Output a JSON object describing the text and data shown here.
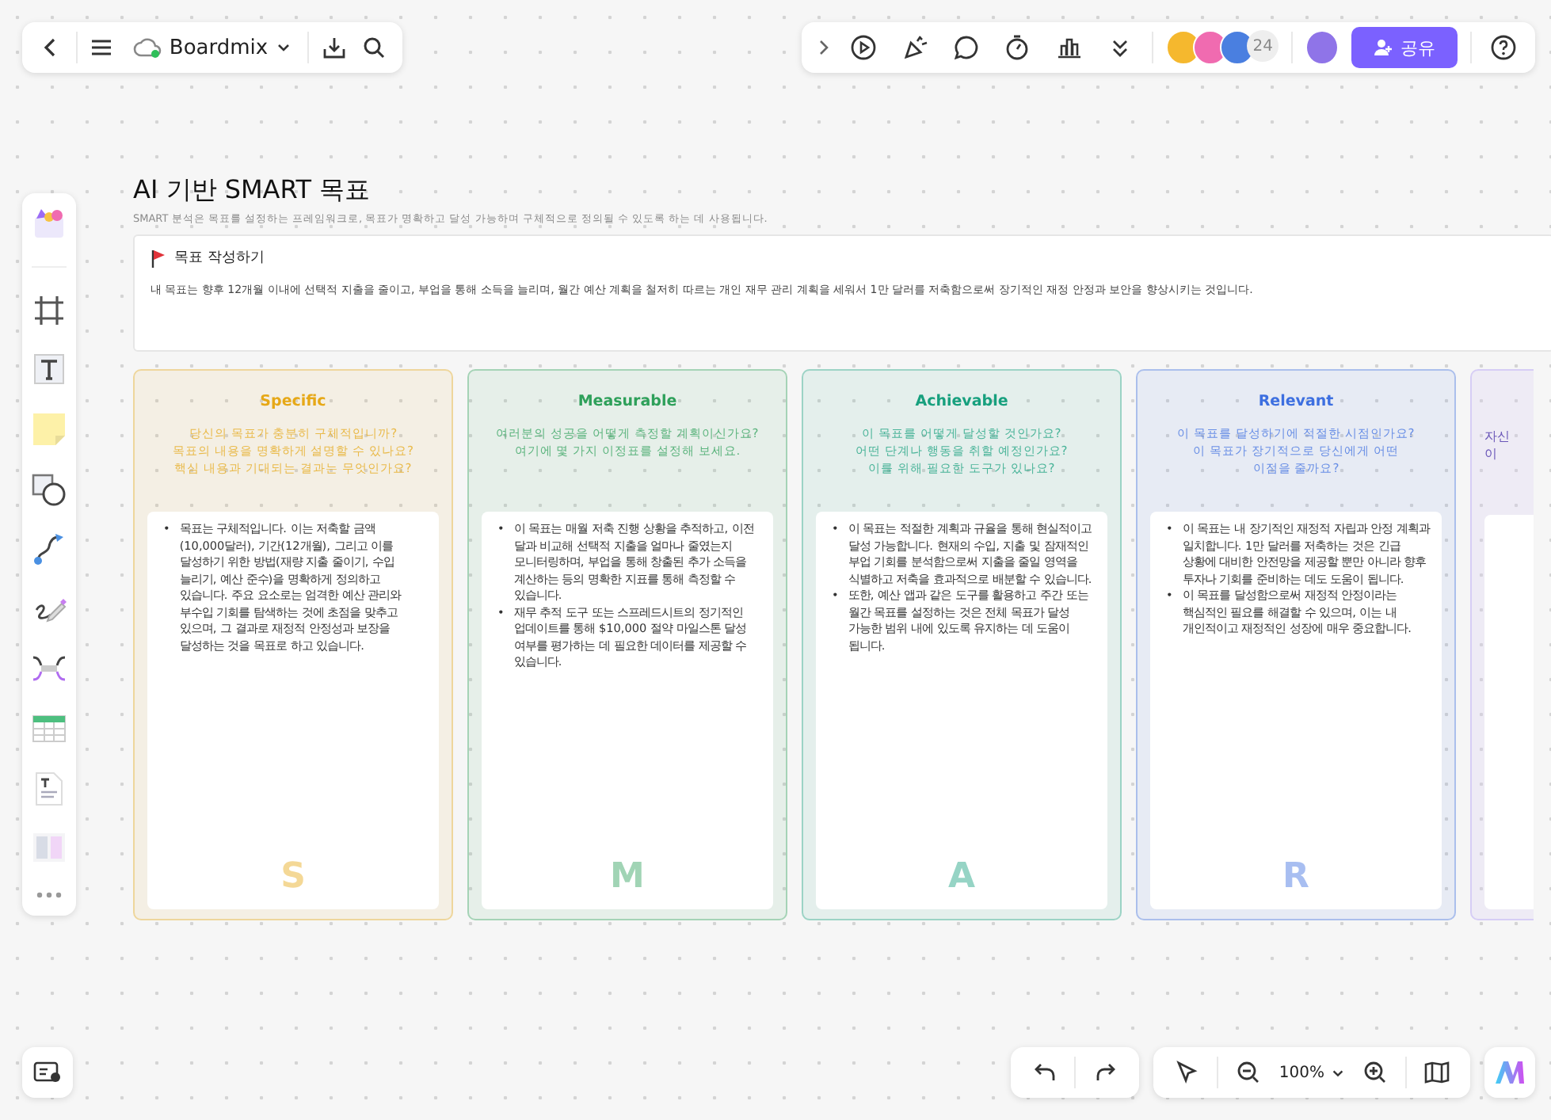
{
  "top_bar": {
    "app_name": "Boardmix"
  },
  "collab_bar": {
    "avatars": [
      {
        "color": "#f5b82e"
      },
      {
        "color": "#f06bb0"
      },
      {
        "color": "#4a7fe0"
      }
    ],
    "more_count": "24",
    "share_label": "공유"
  },
  "board": {
    "title": "AI 기반 SMART 목표",
    "subtitle": "SMART 분석은 목표를 설정하는 프레임워크로, 목표가 명확하고 달성 가능하며 구체적으로 정의될 수 있도록 하는 데 사용됩니다.",
    "goal": {
      "heading": "목표 작성하기",
      "text": "내 목표는 향후 12개월 이내에 선택적 지출을 줄이고, 부업을 통해 소득을 늘리며, 월간 예산 계획을 철저히 따르는 개인 재무 관리 계획을 세워서 1만 달러를 저축함으로써 장기적인 재정 안정과 보안을 향상시키는 것입니다."
    },
    "cards": [
      {
        "kind": "full",
        "color": "#e6a817",
        "title": "Specific",
        "questions": [
          "당신의 목표가 충분히 구체적입니까?",
          "목표의 내용을 명확하게 설명할 수 있나요?",
          "핵심 내용과 기대되는 결과는 무엇인가요?"
        ],
        "bullets": [
          "목표는 구체적입니다. 이는 저축할 금액(10,000달러), 기간(12개월), 그리고 이를 달성하기 위한 방법(재량 지출 줄이기, 수입 늘리기, 예산 준수)을 명확하게 정의하고 있습니다. 주요 요소로는 엄격한 예산 관리와 부수입 기회를 탐색하는 것에 초점을 맞추고 있으며, 그 결과로 재정적 안정성과 보장을 달성하는 것을 목표로 하고 있습니다."
        ],
        "letter": "S"
      },
      {
        "kind": "full",
        "color": "#2ea05a",
        "title": "Measurable",
        "questions": [
          "여러분의 성공을 어떻게 측정할 계획이신가요?",
          "여기에 몇 가지 이정표를 설정해 보세요."
        ],
        "bullets": [
          "이 목표는 매월 저축 진행 상황을 추적하고, 이전 달과 비교해 선택적 지출을 얼마나 줄였는지 모니터링하며, 부업을 통해 창출된 추가 소득을 계산하는 등의 명확한 지표를 통해 측정할 수 있습니다.",
          "재무 추적 도구 또는 스프레드시트의 정기적인 업데이트를 통해 $10,000 절약 마일스톤 달성 여부를 평가하는 데 필요한 데이터를 제공할 수 있습니다."
        ],
        "letter": "M"
      },
      {
        "kind": "full",
        "color": "#17a07e",
        "title": "Achievable",
        "questions": [
          "이 목표를 어떻게 달성할 것인가요?",
          "어떤 단계나 행동을 취할 예정인가요?",
          "이를 위해 필요한 도구가 있나요?"
        ],
        "bullets": [
          "이 목표는 적절한 계획과 규율을 통해 현실적이고 달성 가능합니다. 현재의 수입, 지출 및 잠재적인 부업 기회를 분석함으로써 지출을 줄일 영역을 식별하고 저축을 효과적으로 배분할 수 있습니다.",
          "또한, 예산 앱과 같은 도구를 활용하고 주간 또는 월간 목표를 설정하는 것은 전체 목표가 달성 가능한 범위 내에 있도록 유지하는 데 도움이 됩니다."
        ],
        "letter": "A"
      },
      {
        "kind": "full",
        "color": "#3d6fe0",
        "title": "Relevant",
        "questions": [
          "이 목표를 달성하기에 적절한 시점인가요?",
          "이 목표가 장기적으로 당신에게 어떤",
          "이점을 줄까요?"
        ],
        "bullets": [
          "이 목표는 내 장기적인 재정적 자립과 안정 계획과 일치합니다. 1만 달러를 저축하는 것은 긴급 상황에 대비한 안전망을 제공할 뿐만 아니라 향후 투자나 기회를 준비하는 데도 도움이 됩니다.",
          "이 목표를 달성함으로써 재정적 안정이라는 핵심적인 필요를 해결할 수 있으며, 이는 내 개인적이고 재정적인 성장에 매우 중요합니다."
        ],
        "letter": "R"
      },
      {
        "kind": "partial",
        "color": "#d6cdf5",
        "questions": [
          "자신",
          "이"
        ]
      }
    ]
  },
  "bullet_marker": "•",
  "bottom_bar": {
    "zoom": "100%"
  }
}
